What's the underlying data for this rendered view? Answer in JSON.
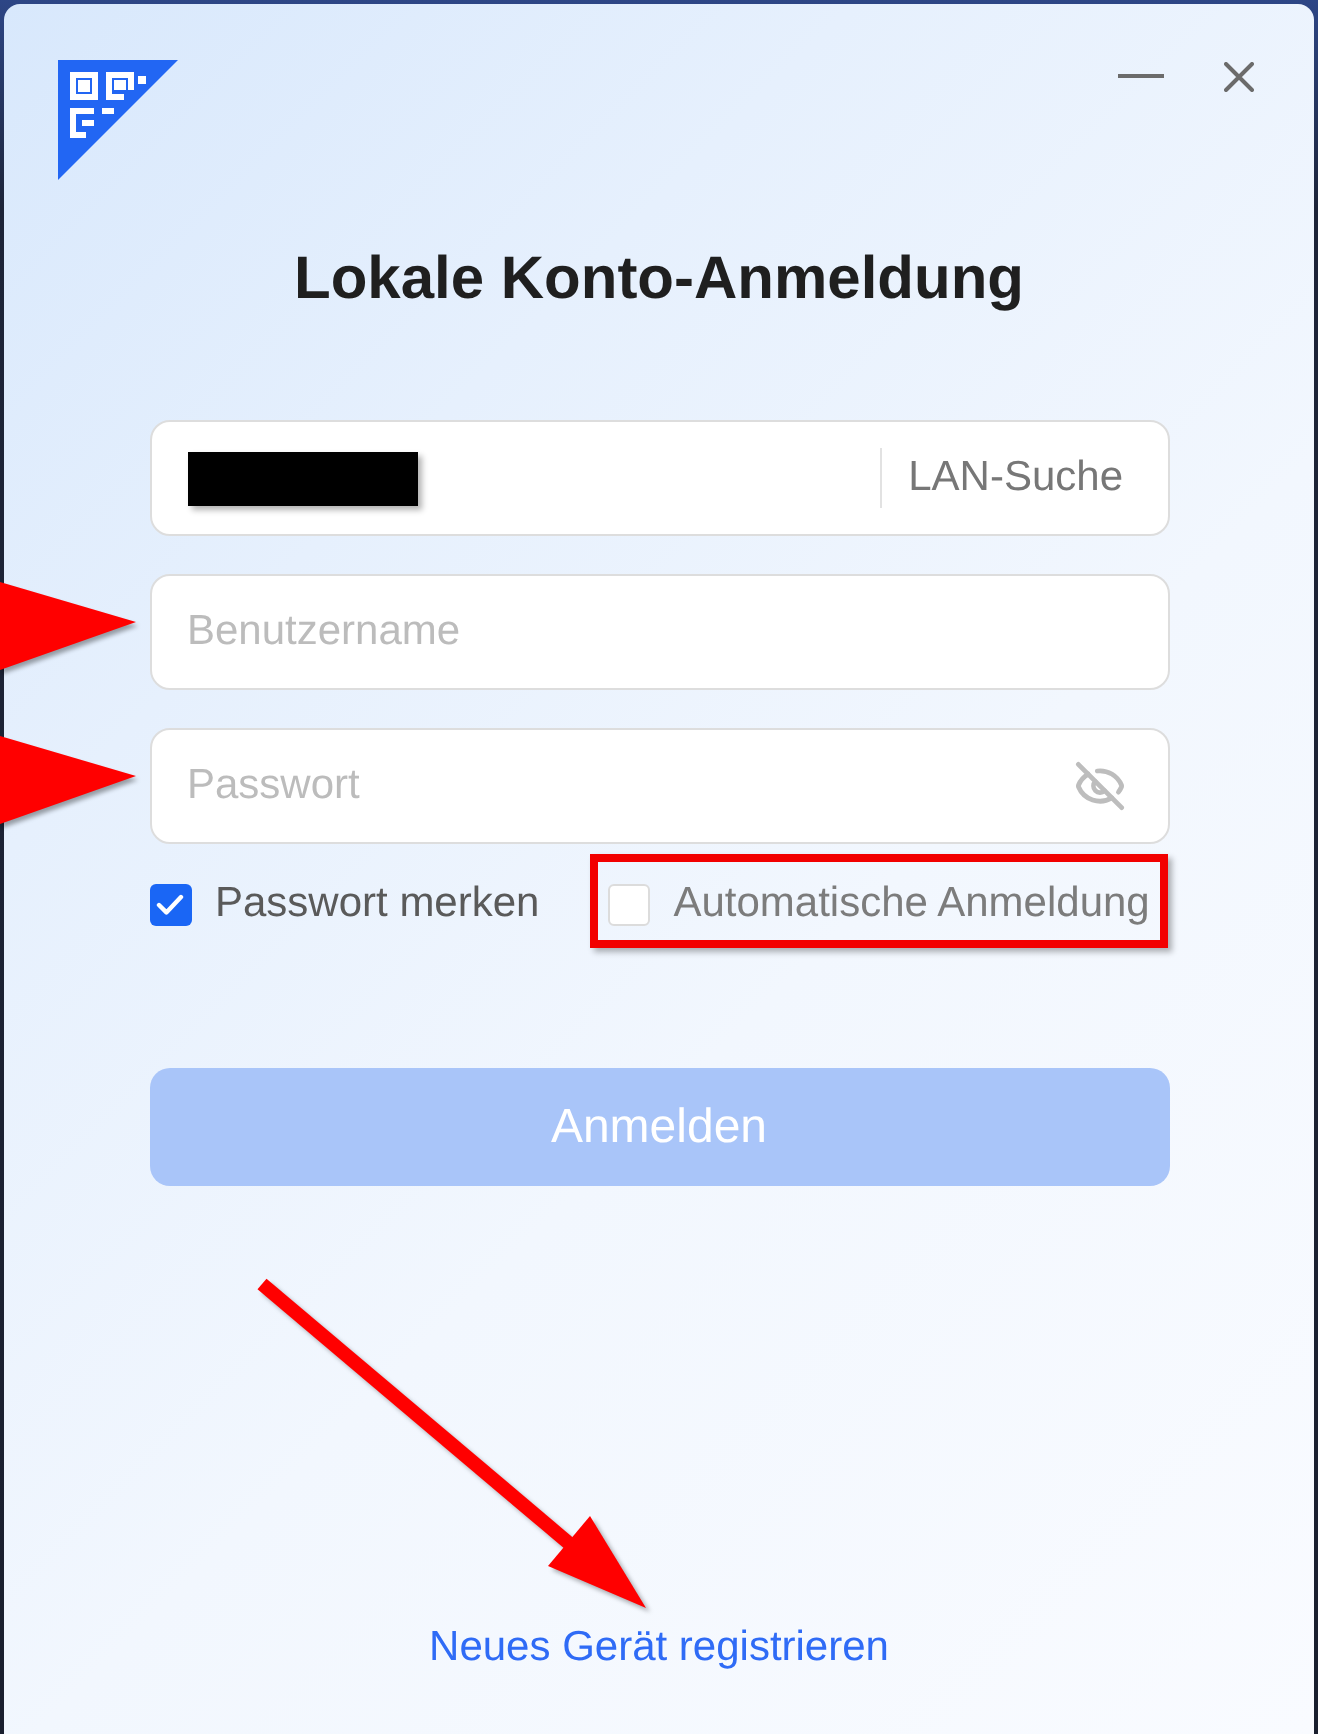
{
  "heading": "Lokale Konto-Anmeldung",
  "fields": [
    {
      "kind": "server",
      "redacted": true,
      "action": "LAN-Suche",
      "annotated": false
    },
    {
      "kind": "text",
      "placeholder": "Benutzername",
      "annotated": true
    },
    {
      "kind": "password",
      "placeholder": "Passwort",
      "visible": false,
      "annotated": true
    }
  ],
  "options": [
    {
      "label": "Passwort merken",
      "checked": true,
      "annotated": false
    },
    {
      "label": "Automatische Anmeldung",
      "checked": false,
      "annotated": true
    }
  ],
  "login_button": {
    "label": "Anmelden",
    "disabled": true
  },
  "register_link": {
    "label": "Neues Gerät registrieren",
    "annotated": true
  }
}
